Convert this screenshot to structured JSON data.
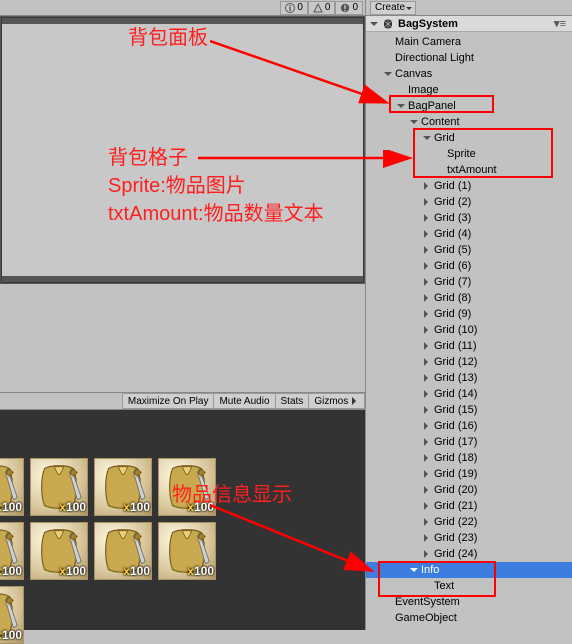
{
  "top_stats": {
    "info_count": "0",
    "warn_count": "0",
    "err_count": "0"
  },
  "game_toolbar": {
    "maximize": "Maximize On Play",
    "mute": "Mute Audio",
    "stats": "Stats",
    "gizmos": "Gizmos"
  },
  "create_label": "Create",
  "scene_name": "BagSystem",
  "tree": [
    {
      "depth": 1,
      "label": "Main Camera",
      "expand": "none"
    },
    {
      "depth": 1,
      "label": "Directional Light",
      "expand": "none"
    },
    {
      "depth": 1,
      "label": "Canvas",
      "expand": "down"
    },
    {
      "depth": 2,
      "label": "Image",
      "expand": "none"
    },
    {
      "depth": 2,
      "label": "BagPanel",
      "expand": "down"
    },
    {
      "depth": 3,
      "label": "Content",
      "expand": "down"
    },
    {
      "depth": 4,
      "label": "Grid",
      "expand": "down"
    },
    {
      "depth": 5,
      "label": "Sprite",
      "expand": "none"
    },
    {
      "depth": 5,
      "label": "txtAmount",
      "expand": "none"
    },
    {
      "depth": 4,
      "label": "Grid (1)",
      "expand": "right"
    },
    {
      "depth": 4,
      "label": "Grid (2)",
      "expand": "right"
    },
    {
      "depth": 4,
      "label": "Grid (3)",
      "expand": "right"
    },
    {
      "depth": 4,
      "label": "Grid (4)",
      "expand": "right"
    },
    {
      "depth": 4,
      "label": "Grid (5)",
      "expand": "right"
    },
    {
      "depth": 4,
      "label": "Grid (6)",
      "expand": "right"
    },
    {
      "depth": 4,
      "label": "Grid (7)",
      "expand": "right"
    },
    {
      "depth": 4,
      "label": "Grid (8)",
      "expand": "right"
    },
    {
      "depth": 4,
      "label": "Grid (9)",
      "expand": "right"
    },
    {
      "depth": 4,
      "label": "Grid (10)",
      "expand": "right"
    },
    {
      "depth": 4,
      "label": "Grid (11)",
      "expand": "right"
    },
    {
      "depth": 4,
      "label": "Grid (12)",
      "expand": "right"
    },
    {
      "depth": 4,
      "label": "Grid (13)",
      "expand": "right"
    },
    {
      "depth": 4,
      "label": "Grid (14)",
      "expand": "right"
    },
    {
      "depth": 4,
      "label": "Grid (15)",
      "expand": "right"
    },
    {
      "depth": 4,
      "label": "Grid (16)",
      "expand": "right"
    },
    {
      "depth": 4,
      "label": "Grid (17)",
      "expand": "right"
    },
    {
      "depth": 4,
      "label": "Grid (18)",
      "expand": "right"
    },
    {
      "depth": 4,
      "label": "Grid (19)",
      "expand": "right"
    },
    {
      "depth": 4,
      "label": "Grid (20)",
      "expand": "right"
    },
    {
      "depth": 4,
      "label": "Grid (21)",
      "expand": "right"
    },
    {
      "depth": 4,
      "label": "Grid (22)",
      "expand": "right"
    },
    {
      "depth": 4,
      "label": "Grid (23)",
      "expand": "right"
    },
    {
      "depth": 4,
      "label": "Grid (24)",
      "expand": "right"
    },
    {
      "depth": 3,
      "label": "Info",
      "expand": "down",
      "selected": true
    },
    {
      "depth": 4,
      "label": "Text",
      "expand": "none"
    },
    {
      "depth": 1,
      "label": "EventSystem",
      "expand": "none"
    },
    {
      "depth": 1,
      "label": "GameObject",
      "expand": "none"
    }
  ],
  "bag_badge": "100",
  "annotations": {
    "a1": "背包面板",
    "a2_l1": "背包格子",
    "a2_l2": "Sprite:物品图片",
    "a2_l3": "txtAmount:物品数量文本",
    "a3": "物品信息显示"
  }
}
